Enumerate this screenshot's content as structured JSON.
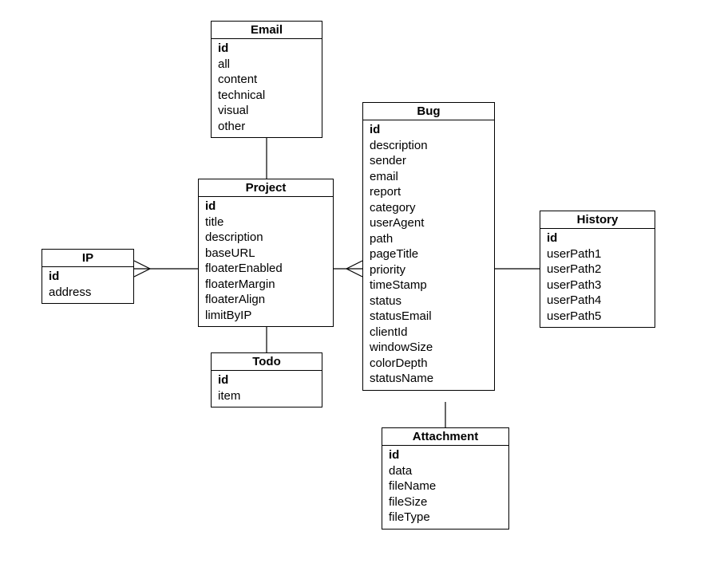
{
  "chart_data": {
    "type": "er-diagram",
    "entities": [
      {
        "name": "Email",
        "key": "id",
        "attributes": [
          "all",
          "content",
          "technical",
          "visual",
          "other"
        ]
      },
      {
        "name": "Project",
        "key": "id",
        "attributes": [
          "title",
          "description",
          "baseURL",
          "floaterEnabled",
          "floaterMargin",
          "floaterAlign",
          "limitByIP"
        ]
      },
      {
        "name": "IP",
        "key": "id",
        "attributes": [
          "address"
        ]
      },
      {
        "name": "Todo",
        "key": "id",
        "attributes": [
          "item"
        ]
      },
      {
        "name": "Bug",
        "key": "id",
        "attributes": [
          "description",
          "sender",
          "email",
          "report",
          "category",
          "userAgent",
          "path",
          "pageTitle",
          "priority",
          "timeStamp",
          "status",
          "statusEmail",
          "clientId",
          "windowSize",
          "colorDepth",
          "statusName"
        ]
      },
      {
        "name": "History",
        "key": "id",
        "attributes": [
          "userPath1",
          "userPath2",
          "userPath3",
          "userPath4",
          "userPath5"
        ]
      },
      {
        "name": "Attachment",
        "key": "id",
        "attributes": [
          "data",
          "fileName",
          "fileSize",
          "fileType"
        ]
      }
    ],
    "relationships": [
      {
        "from": "Email",
        "to": "Project",
        "type": "one-to-one"
      },
      {
        "from": "Project",
        "to": "IP",
        "type": "one-to-many",
        "many_at": "IP"
      },
      {
        "from": "Project",
        "to": "Todo",
        "type": "one-to-one"
      },
      {
        "from": "Project",
        "to": "Bug",
        "type": "one-to-many",
        "many_at": "Bug"
      },
      {
        "from": "Bug",
        "to": "History",
        "type": "one-to-one"
      },
      {
        "from": "Bug",
        "to": "Attachment",
        "type": "one-to-one"
      }
    ]
  },
  "entities": {
    "email": {
      "title": "Email",
      "key": "id",
      "attrs": [
        "all",
        "content",
        "technical",
        "visual",
        "other"
      ]
    },
    "project": {
      "title": "Project",
      "key": "id",
      "attrs": [
        "title",
        "description",
        "baseURL",
        "floaterEnabled",
        "floaterMargin",
        "floaterAlign",
        "limitByIP"
      ]
    },
    "ip": {
      "title": "IP",
      "key": "id",
      "attrs": [
        "address"
      ]
    },
    "todo": {
      "title": "Todo",
      "key": "id",
      "attrs": [
        "item"
      ]
    },
    "bug": {
      "title": "Bug",
      "key": "id",
      "attrs": [
        "description",
        "sender",
        "email",
        "report",
        "category",
        "userAgent",
        "path",
        "pageTitle",
        "priority",
        "timeStamp",
        "status",
        "statusEmail",
        "clientId",
        "windowSize",
        "colorDepth",
        "statusName"
      ]
    },
    "history": {
      "title": "History",
      "key": "id",
      "attrs": [
        "userPath1",
        "userPath2",
        "userPath3",
        "userPath4",
        "userPath5"
      ]
    },
    "attachment": {
      "title": "Attachment",
      "key": "id",
      "attrs": [
        "data",
        "fileName",
        "fileSize",
        "fileType"
      ]
    }
  }
}
